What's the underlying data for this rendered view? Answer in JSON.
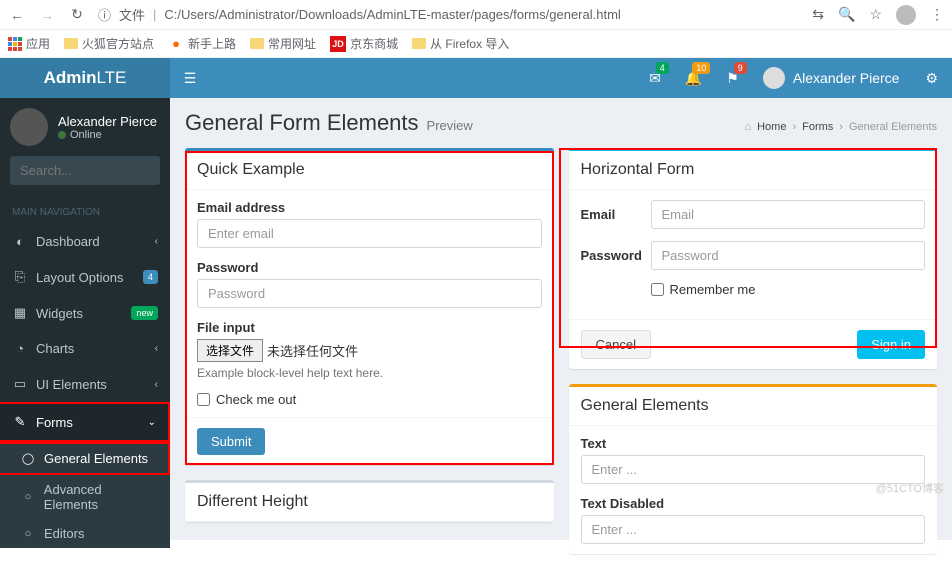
{
  "browser": {
    "url_prefix": "文件",
    "url": "C:/Users/Administrator/Downloads/AdminLTE-master/pages/forms/general.html",
    "bookmarks": {
      "apps": "应用",
      "firefox": "火狐官方站点",
      "newbie": "新手上路",
      "common": "常用网址",
      "jd": "京东商城",
      "jd_badge": "JD",
      "import": "从 Firefox 导入"
    }
  },
  "navbar": {
    "logo_bold": "Admin",
    "logo_light": "LTE",
    "badges": {
      "messages": "4",
      "notifications": "10",
      "tasks": "9"
    },
    "user_name": "Alexander Pierce"
  },
  "sidebar": {
    "user": {
      "name": "Alexander Pierce",
      "status": "Online"
    },
    "search_placeholder": "Search...",
    "header": "MAIN NAVIGATION",
    "items": [
      {
        "label": "Dashboard"
      },
      {
        "label": "Layout Options",
        "badge": "4"
      },
      {
        "label": "Widgets",
        "badge": "new"
      },
      {
        "label": "Charts"
      },
      {
        "label": "UI Elements"
      },
      {
        "label": "Forms"
      }
    ],
    "submenu": [
      {
        "label": "General Elements"
      },
      {
        "label": "Advanced Elements"
      },
      {
        "label": "Editors"
      }
    ]
  },
  "header": {
    "title": "General Form Elements",
    "subtitle": "Preview",
    "breadcrumb": {
      "home": "Home",
      "forms": "Forms",
      "current": "General Elements"
    }
  },
  "quick_example": {
    "title": "Quick Example",
    "email_label": "Email address",
    "email_placeholder": "Enter email",
    "password_label": "Password",
    "password_placeholder": "Password",
    "file_label": "File input",
    "file_button": "选择文件",
    "file_status": "未选择任何文件",
    "file_help": "Example block-level help text here.",
    "check_label": "Check me out",
    "submit": "Submit"
  },
  "horizontal_form": {
    "title": "Horizontal Form",
    "email_label": "Email",
    "email_placeholder": "Email",
    "password_label": "Password",
    "password_placeholder": "Password",
    "remember": "Remember me",
    "cancel": "Cancel",
    "signin": "Sign in"
  },
  "different_height": {
    "title": "Different Height"
  },
  "general_elements": {
    "title": "General Elements",
    "text_label": "Text",
    "text_placeholder": "Enter ...",
    "disabled_label": "Text Disabled",
    "disabled_placeholder": "Enter ..."
  },
  "watermark": "@51CTO博客"
}
